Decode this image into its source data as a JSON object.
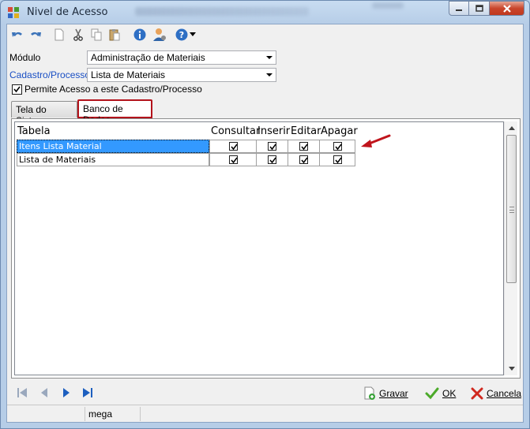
{
  "window": {
    "title": "Nivel de Acesso"
  },
  "toolbar": {
    "undo_icon": "undo-icon",
    "redo_icon": "redo-icon",
    "new_icon": "new-document-icon",
    "cut_icon": "cut-icon",
    "copy_icon": "copy-icon",
    "paste_icon": "paste-icon",
    "info_icon": "info-icon",
    "user_icon": "user-icon",
    "help_icon": "help-icon"
  },
  "form": {
    "modulo_label": "Módulo",
    "modulo_value": "Administração de Materiais",
    "cadastro_label": "Cadastro/Processo",
    "cadastro_value": "Lista de Materiais",
    "permite_label": "Permite Acesso a este Cadastro/Processo",
    "permite_checked": true
  },
  "tabs": [
    {
      "label": "Tela do Sistema",
      "active": false
    },
    {
      "label": "Banco de Dados",
      "active": true
    }
  ],
  "grid": {
    "headers": {
      "tabela": "Tabela",
      "consultar": "Consultar",
      "inserir": "Inserir",
      "editar": "Editar",
      "apagar": "Apagar"
    },
    "rows": [
      {
        "tabela": "Itens Lista Material",
        "consultar": true,
        "inserir": true,
        "editar": true,
        "apagar": true,
        "selected": true
      },
      {
        "tabela": "Lista de Materiais",
        "consultar": true,
        "inserir": true,
        "editar": true,
        "apagar": true,
        "selected": false
      }
    ]
  },
  "actions": {
    "gravar": "Gravar",
    "ok": "OK",
    "cancela": "Cancela"
  },
  "status": {
    "user": "mega"
  },
  "colors": {
    "highlight_border": "#b3131b",
    "selection": "#3399ff",
    "arrow": "#c0141c"
  }
}
